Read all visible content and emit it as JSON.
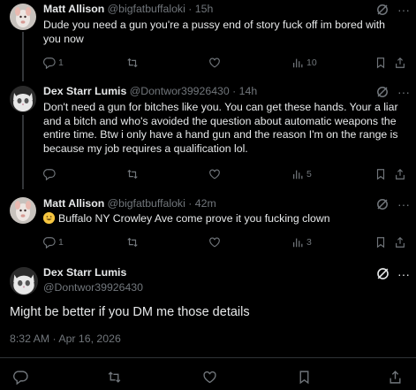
{
  "colors": {
    "background": "#000000",
    "text": "#e7e9ea",
    "secondary": "#71767b",
    "divider": "#2f3336"
  },
  "tweets": [
    {
      "name": "Matt Allison",
      "handle": "@bigfatbuffaloki",
      "time": "15h",
      "text": "Dude you need a gun you're a pussy end of story fuck off im bored with you now",
      "replies": "1",
      "retweets": "",
      "likes": "",
      "views": "10"
    },
    {
      "name": "Dex Starr Lumis",
      "handle": "@Dontwor39926430",
      "time": "14h",
      "text": "Don't need a gun for bitches like you. You can get these hands.  Your a liar and a bitch and who's avoided the question about automatic weapons the entire time.  Btw i only have a hand gun and the reason I'm on the range is because my job requires a qualification lol.",
      "replies": "",
      "retweets": "",
      "likes": "",
      "views": "5"
    },
    {
      "name": "Matt Allison",
      "handle": "@bigfatbuffaloki",
      "time": "42m",
      "emoji": "grinning-face-emoji",
      "text": "Buffalo NY Crowley Ave come prove it you fucking clown",
      "replies": "1",
      "retweets": "",
      "likes": "",
      "views": "3"
    }
  ],
  "main_tweet": {
    "name": "Dex Starr Lumis",
    "handle": "@Dontwor39926430",
    "text": "Might be better if you DM me those details",
    "timestamp": "8:32 AM · Apr 16, 2026"
  },
  "separator_dot": "·",
  "icons": [
    "reply-icon",
    "retweet-icon",
    "like-icon",
    "views-icon",
    "bookmark-icon",
    "share-icon",
    "grok-icon",
    "more-icon"
  ]
}
